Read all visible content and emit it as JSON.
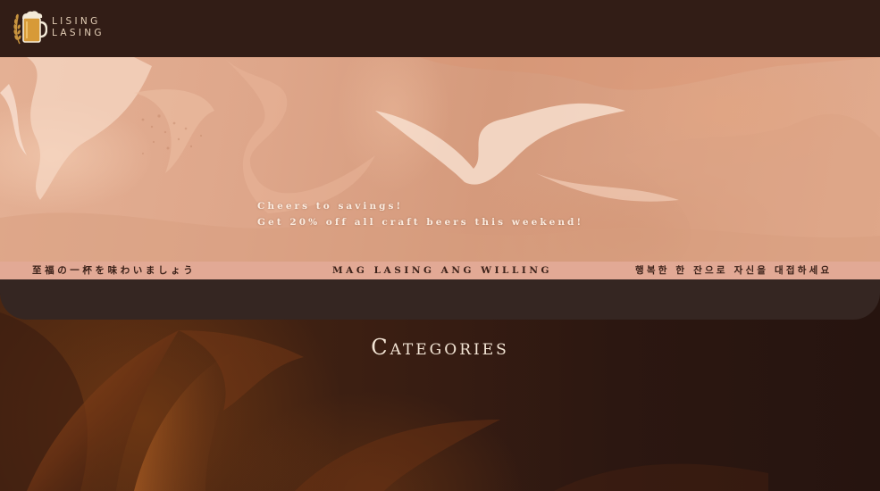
{
  "brand": {
    "logo_icon": "beer-mug-with-wheat-icon",
    "line1": "LISING",
    "line2": "LASING"
  },
  "hero": {
    "line1": "Cheers to savings!",
    "line2": "Get 20% off all craft beers this weekend!"
  },
  "strip": {
    "japanese": "至福の一杯を味わいましょう",
    "filipino": "MAG LASING ANG WILLING",
    "korean": "행복한 한 잔으로 자신을 대접하세요"
  },
  "categories": {
    "title": "Categories"
  },
  "colors": {
    "header_bg": "#321d16",
    "strip_bg": "#e2a995",
    "band_bg": "#352622",
    "hero_text": "#fbece0",
    "brand_text": "#e2cdb5"
  }
}
